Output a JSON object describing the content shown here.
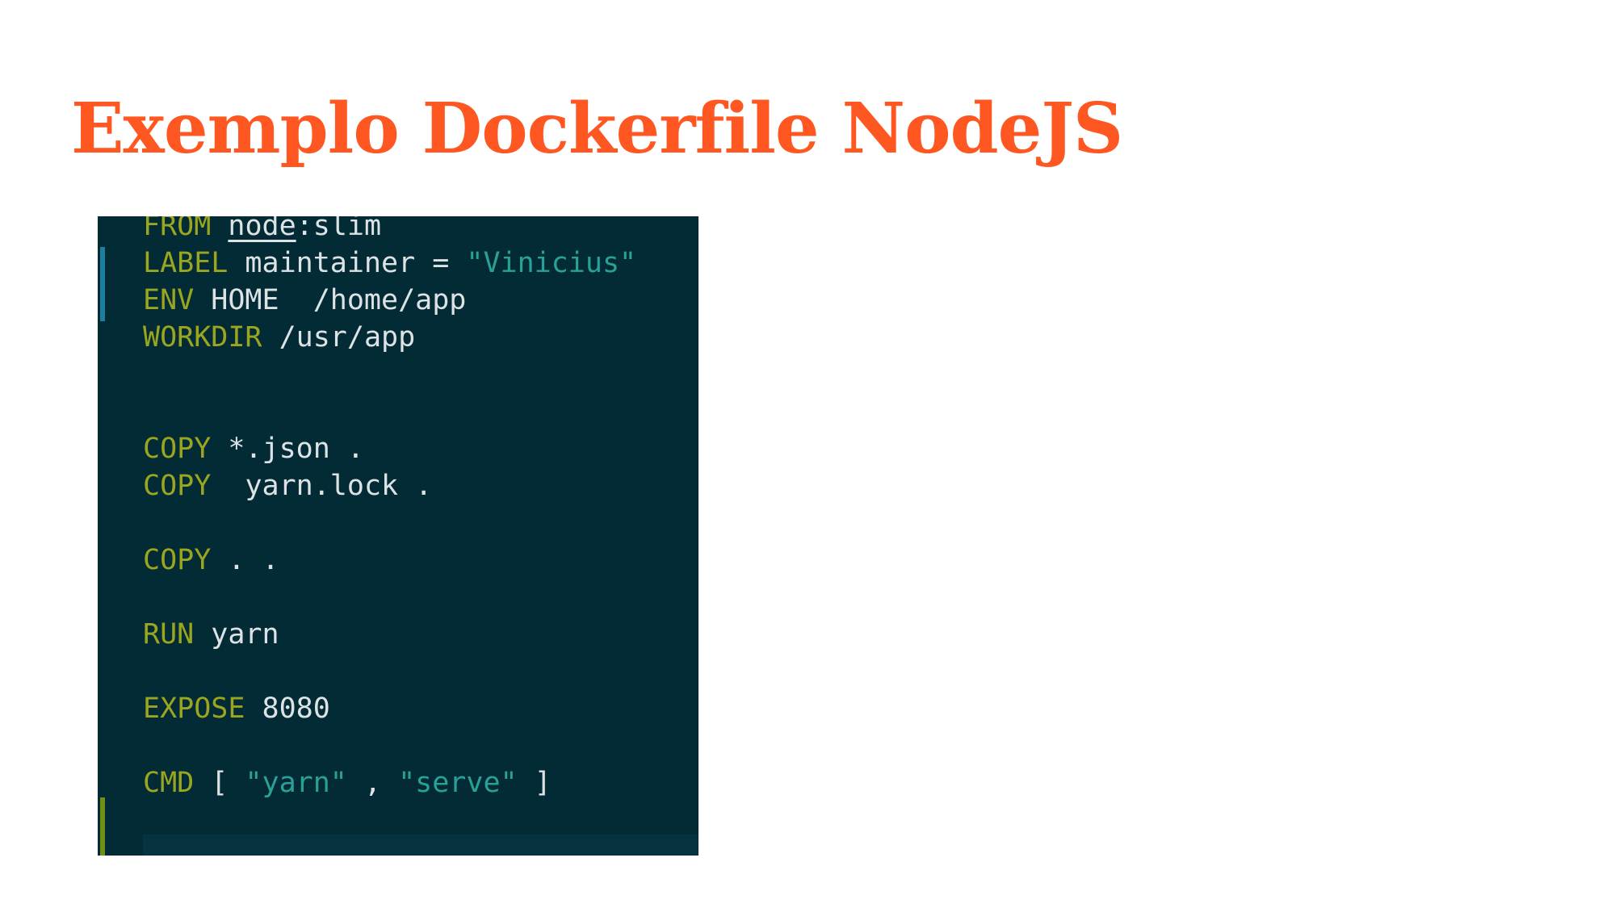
{
  "slide": {
    "title": "Exemplo Dockerfile NodeJS"
  },
  "code": {
    "from_kw": "FROM",
    "from_image": "node",
    "from_tag": ":slim",
    "label_kw": "LABEL",
    "label_body": " maintainer = ",
    "label_value": "\"Vinicius\"",
    "env_kw": "ENV",
    "env_body": " HOME  /home/app",
    "workdir_kw": "WORKDIR",
    "workdir_body": " /usr/app",
    "copy1_kw": "COPY",
    "copy1_body": " *.json .",
    "copy2_kw": "COPY",
    "copy2_body": "  yarn.lock .",
    "copy3_kw": "COPY",
    "copy3_body": " . .",
    "run_kw": "RUN",
    "run_body": " yarn",
    "expose_kw": "EXPOSE",
    "expose_body": " 8080",
    "cmd_kw": "CMD",
    "cmd_open": " [ ",
    "cmd_arg1": "\"yarn\"",
    "cmd_sep": " , ",
    "cmd_arg2": "\"serve\"",
    "cmd_close": " ]"
  },
  "colors": {
    "title": "#ff5722",
    "editor_background": "#032b35",
    "keyword": "#9aa520",
    "string": "#2aa198",
    "text": "#dde3e4"
  }
}
